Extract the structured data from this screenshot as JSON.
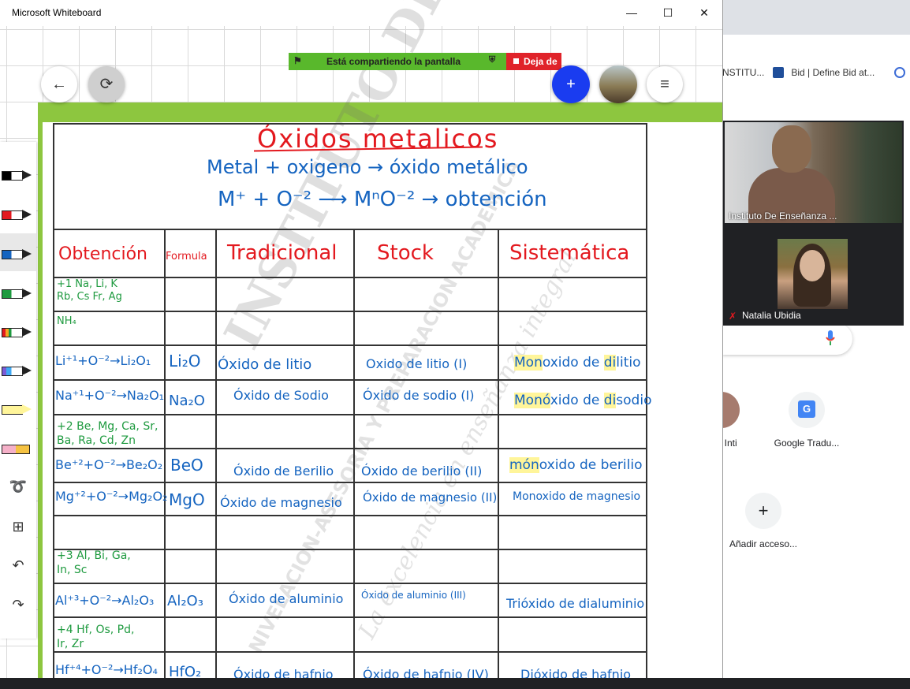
{
  "window": {
    "title": "Microsoft Whiteboard",
    "minimize": "—",
    "maximize": "☐",
    "close": "✕"
  },
  "share_bar": {
    "text": "Está compartiendo la pantalla",
    "stop_label": "Deja de"
  },
  "buttons": {
    "back": "←",
    "sync": "⟳",
    "invite": "+",
    "menu": "≡"
  },
  "chrome": {
    "bookmarks": [
      {
        "label": "NSTITU..."
      },
      {
        "label": "Bid | Define Bid at..."
      }
    ],
    "shortcuts": [
      {
        "label": "ac - Inti"
      },
      {
        "label": "Google Tradu..."
      },
      {
        "label": "Añadir acceso..."
      }
    ],
    "add_symbol": "+"
  },
  "whiteboard": {
    "title": "Óxidos metalicos",
    "eq1": "Metal + oxigeno → óxido metálico",
    "eq2": "M⁺ + O⁻² ⟶ MⁿO⁻² → obtención",
    "headers": [
      "Obtención",
      "Formula",
      "Tradicional",
      "Stock",
      "Sistemática"
    ],
    "groups": {
      "g1": "+1 Na, Li, K\nRb, Cs Fr, Ag",
      "g1b": "NH₄",
      "g2": "+2 Be, Mg, Ca, Sr,\nBa, Ra, Cd, Zn",
      "g3": "+3 Al, Bi, Ga,\nIn, Sc",
      "g4": "+4 Hf, Os, Pd,\nIr, Zr"
    },
    "rows": [
      {
        "obtencion": "Li⁺¹+O⁻²→Li₂O₁",
        "formula": "Li₂O",
        "tradicional": "Óxido de litio",
        "stock": "Oxido de litio (I)",
        "sistematica_pre": "Mon",
        "sistematica_mid": "oxido de ",
        "sistematica_hl": "di",
        "sistematica_post": "litio"
      },
      {
        "obtencion": "Na⁺¹+O⁻²→Na₂O₁",
        "formula": "Na₂O",
        "tradicional": "Óxido de Sodio",
        "stock": "Óxido de sodio (I)",
        "sistematica_pre": "Monó",
        "sistematica_mid": "xido de ",
        "sistematica_hl": "di",
        "sistematica_post": "sodio"
      },
      {
        "obtencion": "Be⁺²+O⁻²→Be₂O₂",
        "formula": "BeO",
        "tradicional": "Óxido de Berilio",
        "stock": "Óxido de berilio (II)",
        "sistematica_pre": "món",
        "sistematica_mid": "oxido de berilio",
        "sistematica_hl": "",
        "sistematica_post": ""
      },
      {
        "obtencion": "Mg⁺²+O⁻²→Mg₂O₂",
        "formula": "MgO",
        "tradicional": "Óxido de magnesio",
        "stock": "Óxido de magnesio (II)",
        "sistematica_pre": "",
        "sistematica_mid": "Monoxido de magnesio",
        "sistematica_hl": "",
        "sistematica_post": ""
      },
      {
        "obtencion": "Al⁺³+O⁻²→Al₂O₃",
        "formula": "Al₂O₃",
        "tradicional": "Óxido de aluminio",
        "stock": "Óxido de aluminio (III)",
        "sistematica_pre": "",
        "sistematica_mid": "Trióxido de dialuminio",
        "sistematica_hl": "",
        "sistematica_post": ""
      },
      {
        "obtencion": "Hf⁺⁴+O⁻²→Hf₂O₄",
        "formula": "HfO₂",
        "tradicional": "Óxido de hafnio",
        "stock": "Óxido de hafnio (IV)",
        "sistematica_pre": "",
        "sistematica_mid": "Dióxido de hafnio",
        "sistematica_hl": "",
        "sistematica_post": ""
      }
    ],
    "watermark": "INSTITUTO DE ENSEÑANZA CONTINUA",
    "watermark_sub": "La excelencia en enseñanza integral",
    "watermark_small": "NIVELACION-ASESORIA Y PREPARACION ACADEMICA"
  },
  "video": {
    "participant1": "Instituto De Enseñanza ...",
    "participant2": "Natalia Ubidia"
  },
  "colors": {
    "accent_blue": "#1a3cf0",
    "frame_green": "#8dc63f",
    "ink_red": "#e3191f",
    "ink_blue": "#1564c0",
    "ink_green": "#1e9a3f"
  }
}
